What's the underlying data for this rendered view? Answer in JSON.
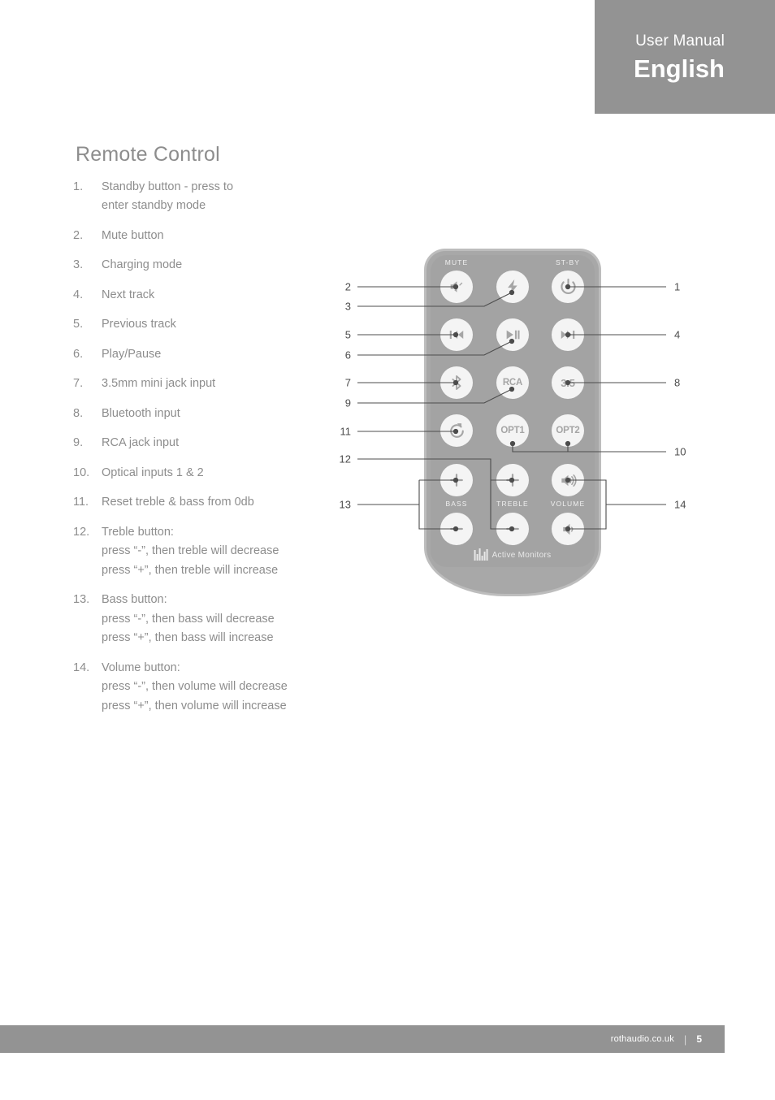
{
  "header": {
    "subtitle": "User Manual",
    "title": "English",
    "background": "#939393"
  },
  "page_title": "Remote Control",
  "list": [
    {
      "num": "1.",
      "lines": [
        "Standby button - press to",
        "enter standby mode"
      ]
    },
    {
      "num": "2.",
      "lines": [
        "Mute button"
      ]
    },
    {
      "num": "3.",
      "lines": [
        "Charging mode"
      ]
    },
    {
      "num": "4.",
      "lines": [
        "Next track"
      ]
    },
    {
      "num": "5.",
      "lines": [
        "Previous track"
      ]
    },
    {
      "num": "6.",
      "lines": [
        "Play/Pause"
      ]
    },
    {
      "num": "7.",
      "lines": [
        "3.5mm mini jack input"
      ]
    },
    {
      "num": "8.",
      "lines": [
        "Bluetooth input"
      ]
    },
    {
      "num": "9.",
      "lines": [
        "RCA jack input"
      ]
    },
    {
      "num": "10.",
      "lines": [
        "Optical inputs 1 & 2"
      ]
    },
    {
      "num": "11.",
      "lines": [
        "Reset treble & bass from 0db"
      ]
    },
    {
      "num": "12.",
      "lines": [
        "Treble button:",
        "press “-”, then treble will decrease",
        "press “+”, then treble will increase"
      ]
    },
    {
      "num": "13.",
      "lines": [
        "Bass button:",
        "press “-”, then bass will decrease",
        "press “+”, then bass will increase"
      ]
    },
    {
      "num": "14.",
      "lines": [
        "Volume button:",
        "press “-”, then volume will decrease",
        "press “+”, then volume will increase"
      ]
    }
  ],
  "remote": {
    "body_color": "#a8a8a8",
    "button_color": "#f4f4f4",
    "glyph_color": "#a5a5a5",
    "labels": {
      "mute": "MUTE",
      "standby": "ST-BY",
      "bass": "BASS",
      "treble": "TREBLE",
      "volume": "VOLUME"
    },
    "buttons": [
      {
        "id": "mute",
        "icon": "mute-icon",
        "text": ""
      },
      {
        "id": "charging",
        "icon": "lightning-bolt-icon",
        "text": ""
      },
      {
        "id": "standby",
        "icon": "power-icon",
        "text": ""
      },
      {
        "id": "prev-track",
        "icon": "previous-track-icon",
        "text": ""
      },
      {
        "id": "play-pause",
        "icon": "play-pause-icon",
        "text": ""
      },
      {
        "id": "next-track",
        "icon": "next-track-icon",
        "text": ""
      },
      {
        "id": "bluetooth",
        "icon": "bluetooth-icon",
        "text": ""
      },
      {
        "id": "rca",
        "icon": "",
        "text": "RCA"
      },
      {
        "id": "jack-35",
        "icon": "",
        "text": "3.5"
      },
      {
        "id": "reset",
        "icon": "reset-circle-icon",
        "text": ""
      },
      {
        "id": "opt1",
        "icon": "",
        "text": "OPT1"
      },
      {
        "id": "opt2",
        "icon": "",
        "text": "OPT2"
      },
      {
        "id": "bass-plus",
        "icon": "plus-icon",
        "text": ""
      },
      {
        "id": "treble-plus",
        "icon": "plus-icon",
        "text": ""
      },
      {
        "id": "volume-up",
        "icon": "volume-up-icon",
        "text": ""
      },
      {
        "id": "bass-minus",
        "icon": "minus-icon",
        "text": ""
      },
      {
        "id": "treble-minus",
        "icon": "minus-icon",
        "text": ""
      },
      {
        "id": "volume-down",
        "icon": "volume-down-icon",
        "text": ""
      }
    ],
    "brand": {
      "mark": "roth-logo",
      "text": "Active Monitors"
    }
  },
  "callouts": {
    "left": [
      "2",
      "3",
      "5",
      "6",
      "7",
      "9",
      "11",
      "12",
      "13"
    ],
    "right": [
      "1",
      "4",
      "8",
      "10",
      "14"
    ]
  },
  "footer": {
    "url": "rothaudio.co.uk",
    "separator": "|",
    "page": "5",
    "background": "#939393"
  }
}
